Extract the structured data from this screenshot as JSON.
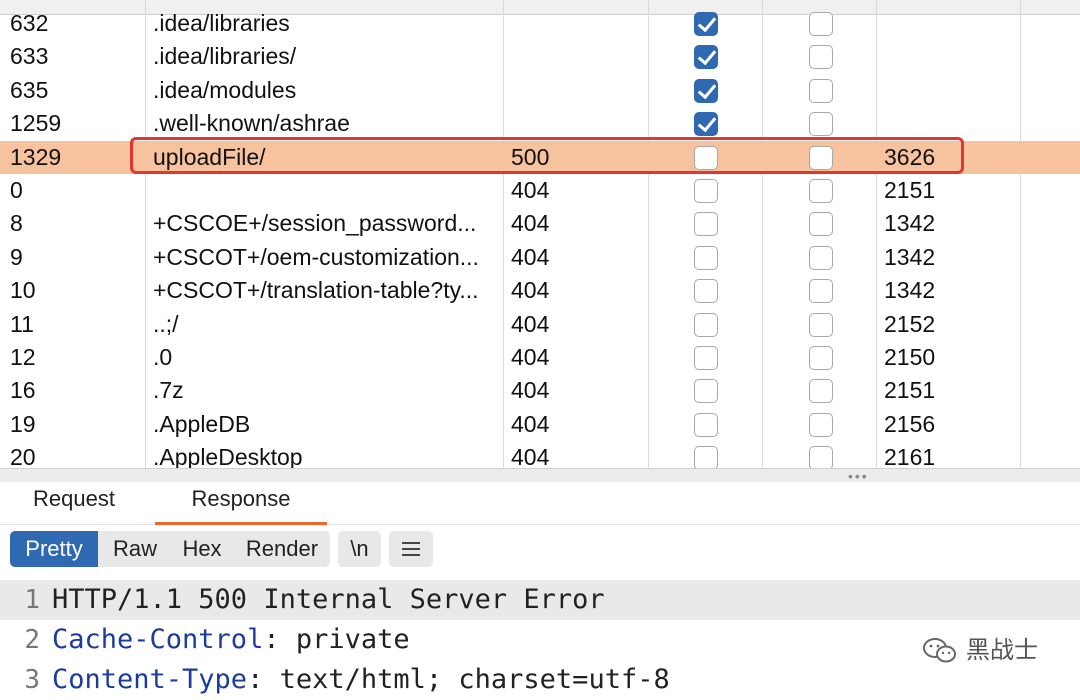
{
  "table": {
    "rows": [
      {
        "request": "632",
        "payload": ".idea/libraries",
        "status": "",
        "error": true,
        "timeout": false,
        "length": ""
      },
      {
        "request": "633",
        "payload": ".idea/libraries/",
        "status": "",
        "error": true,
        "timeout": false,
        "length": ""
      },
      {
        "request": "635",
        "payload": ".idea/modules",
        "status": "",
        "error": true,
        "timeout": false,
        "length": ""
      },
      {
        "request": "1259",
        "payload": ".well-known/ashrae",
        "status": "",
        "error": true,
        "timeout": false,
        "length": ""
      },
      {
        "request": "1329",
        "payload": "uploadFile/",
        "status": "500",
        "error": false,
        "timeout": false,
        "length": "3626",
        "selected": true
      },
      {
        "request": "0",
        "payload": "",
        "status": "404",
        "error": false,
        "timeout": false,
        "length": "2151"
      },
      {
        "request": "8",
        "payload": "+CSCOE+/session_password...",
        "status": "404",
        "error": false,
        "timeout": false,
        "length": "1342"
      },
      {
        "request": "9",
        "payload": "+CSCOT+/oem-customization...",
        "status": "404",
        "error": false,
        "timeout": false,
        "length": "1342"
      },
      {
        "request": "10",
        "payload": "+CSCOT+/translation-table?ty...",
        "status": "404",
        "error": false,
        "timeout": false,
        "length": "1342"
      },
      {
        "request": "11",
        "payload": "..;/",
        "status": "404",
        "error": false,
        "timeout": false,
        "length": "2152"
      },
      {
        "request": "12",
        "payload": ".0",
        "status": "404",
        "error": false,
        "timeout": false,
        "length": "2150"
      },
      {
        "request": "16",
        "payload": ".7z",
        "status": "404",
        "error": false,
        "timeout": false,
        "length": "2151"
      },
      {
        "request": "19",
        "payload": ".AppleDB",
        "status": "404",
        "error": false,
        "timeout": false,
        "length": "2156"
      },
      {
        "request": "20",
        "payload": ".AppleDesktop",
        "status": "404",
        "error": false,
        "timeout": false,
        "length": "2161"
      }
    ]
  },
  "splitter": {
    "grip": "•••"
  },
  "tabs": {
    "request": "Request",
    "response": "Response"
  },
  "toolbar": {
    "pretty": "Pretty",
    "raw": "Raw",
    "hex": "Hex",
    "render": "Render",
    "newline": "\\n"
  },
  "response": {
    "lines": [
      {
        "num": "1",
        "name": "",
        "rest": "HTTP/1.1 500 Internal Server Error"
      },
      {
        "num": "2",
        "name": "Cache-Control",
        "rest": ": private"
      },
      {
        "num": "3",
        "name": "Content-Type",
        "rest": ": text/html; charset=utf-8"
      }
    ]
  },
  "watermark": {
    "text": "黑战士",
    "icon": "wechat-icon"
  },
  "colors": {
    "selected_row": "#f7c39e",
    "highlight": "#e0382c",
    "accent": "#2f69b1",
    "tab_underline": "#e8692a"
  }
}
